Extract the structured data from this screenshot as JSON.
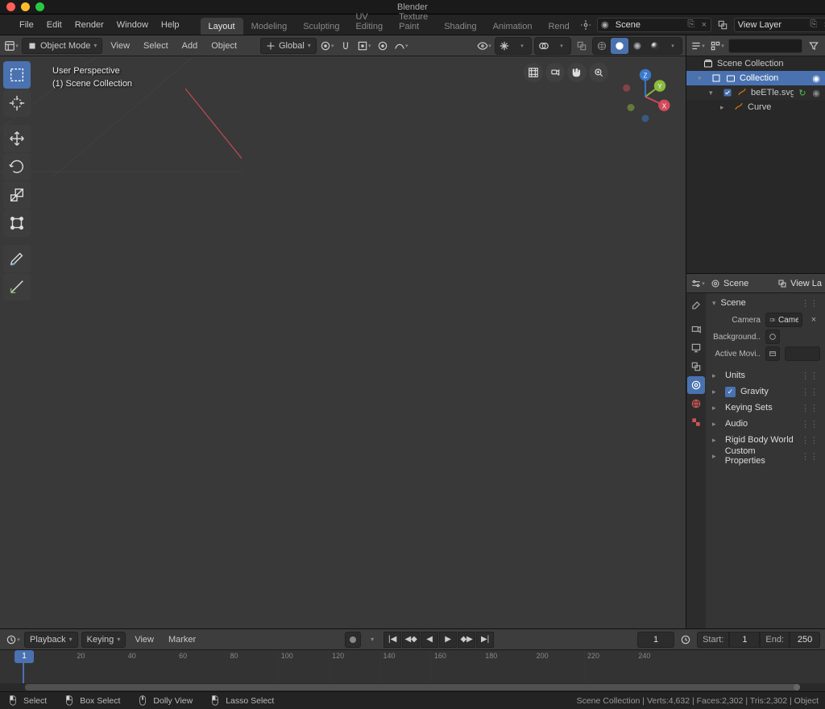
{
  "title": "Blender",
  "menu": [
    "File",
    "Edit",
    "Render",
    "Window",
    "Help"
  ],
  "workspaces": [
    "Layout",
    "Modeling",
    "Sculpting",
    "UV Editing",
    "Texture Paint",
    "Shading",
    "Animation",
    "Rend"
  ],
  "active_workspace": 0,
  "scene_field": "Scene",
  "layer_field": "View Layer",
  "vp_header": {
    "mode": "Object Mode",
    "menus": [
      "View",
      "Select",
      "Add",
      "Object"
    ],
    "orient": "Global"
  },
  "vp_overlay": {
    "line1": "User Perspective",
    "line2": "(1) Scene Collection"
  },
  "outliner": {
    "root": "Scene Collection",
    "collection": "Collection",
    "obj": "beETle.svg",
    "curve": "Curve"
  },
  "props": {
    "scene_crumb": "Scene",
    "view_layer_crumb": "View La",
    "section": "Scene",
    "camera_lbl": "Camera",
    "camera_val": "Came",
    "background_lbl": "Background..",
    "active_movie_lbl": "Active Movi..",
    "panels": [
      "Units",
      "Gravity",
      "Keying Sets",
      "Audio",
      "Rigid Body World",
      "Custom Properties"
    ]
  },
  "timeline": {
    "menus": [
      "Playback",
      "Keying",
      "View",
      "Marker"
    ],
    "current": "1",
    "start_lbl": "Start:",
    "start_val": "1",
    "end_lbl": "End:",
    "end_val": "250",
    "ticks": [
      20,
      40,
      60,
      80,
      100,
      120,
      140,
      160,
      180,
      200,
      220,
      240
    ],
    "playhead": "1"
  },
  "status": {
    "left": [
      {
        "icon": "mouse-left",
        "text": "Select"
      },
      {
        "icon": "mouse-left",
        "text": "Box Select"
      },
      {
        "icon": "mouse-mid",
        "text": "Dolly View"
      },
      {
        "icon": "mouse-left",
        "text": "Lasso Select"
      }
    ],
    "right": "Scene Collection | Verts:4,632 | Faces:2,302 | Tris:2,302 | Object"
  },
  "colors": {
    "accent": "#4a72b0",
    "axis_x": "#d44a5a",
    "axis_y": "#8bbb3c",
    "axis_z": "#3a7acc"
  }
}
